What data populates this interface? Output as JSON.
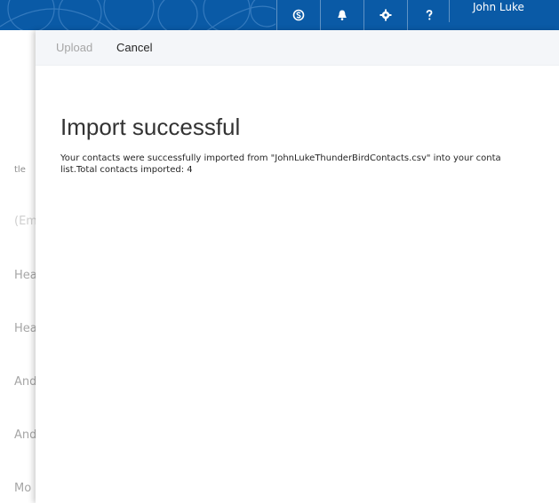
{
  "header": {
    "icons": [
      "skype-icon",
      "bell-icon",
      "gear-icon",
      "help-icon"
    ],
    "user_name": "John Luke",
    "bar_color": "#0a5aa6"
  },
  "left_column": {
    "labels": [
      "tle",
      "(Em",
      "Hea",
      "Hea",
      "And",
      "And",
      "Mo"
    ]
  },
  "command_bar": {
    "upload_label": "Upload",
    "cancel_label": "Cancel"
  },
  "content": {
    "title": "Import successful",
    "message_line1": "Your contacts were successfully imported from \"JohnLukeThunderBirdContacts.csv\" into your conta",
    "message_line2": "list.Total contacts imported: 4"
  }
}
